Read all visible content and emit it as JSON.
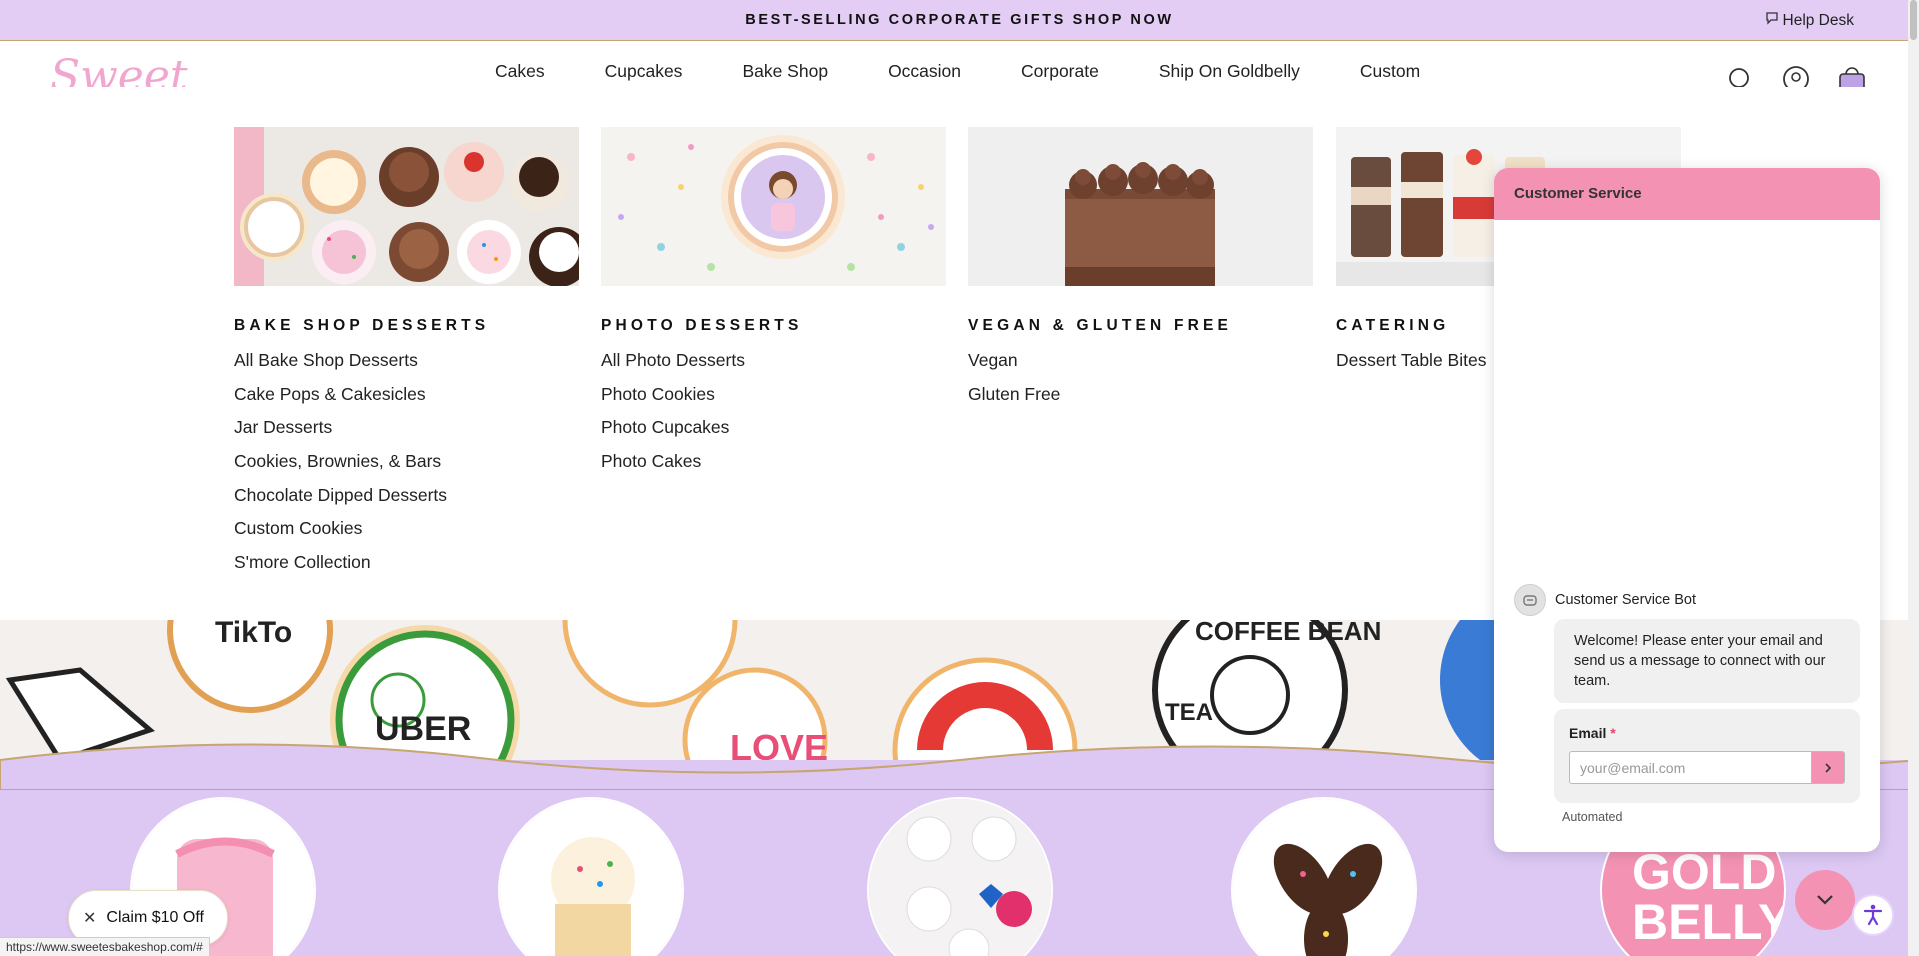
{
  "announcement": {
    "text": "BEST-SELLING CORPORATE GIFTS SHOP NOW",
    "help_desk": "Help Desk"
  },
  "header": {
    "logo_text": "Sweet E's",
    "nav": [
      "Cakes",
      "Cupcakes",
      "Bake Shop",
      "Occasion",
      "Corporate",
      "Ship On Goldbelly",
      "Custom"
    ],
    "active_nav": "Bake Shop",
    "icons": [
      "search-icon",
      "account-icon",
      "cart-icon"
    ]
  },
  "mega_menu": {
    "columns": [
      {
        "title": "BAKE SHOP DESSERTS",
        "links": [
          "All Bake Shop Desserts",
          "Cake Pops & Cakesicles",
          "Jar Desserts",
          "Cookies, Brownies, & Bars",
          "Chocolate Dipped Desserts",
          "Custom Cookies",
          "S'more Collection"
        ]
      },
      {
        "title": "PHOTO DESSERTS",
        "links": [
          "All Photo Desserts",
          "Photo Cookies",
          "Photo Cupcakes",
          "Photo Cakes"
        ]
      },
      {
        "title": "VEGAN & GLUTEN FREE",
        "links": [
          "Vegan",
          "Gluten Free"
        ]
      },
      {
        "title": "CATERING",
        "links": [
          "Dessert Table Bites"
        ]
      }
    ]
  },
  "hero": {
    "cookie_texts": [
      "TikTo",
      "UBER",
      "COFFEE BEAN",
      "TEA",
      "LOVE"
    ]
  },
  "category_circles": {
    "goldbelly_text": [
      "GOLD",
      "BELLY"
    ]
  },
  "chat": {
    "header": "Customer Service",
    "bot_name": "Customer Service Bot",
    "welcome": "Welcome! Please enter your email and send us a message to connect with our team.",
    "email_label": "Email",
    "required_mark": "*",
    "email_placeholder": "your@email.com",
    "automated": "Automated"
  },
  "promo": {
    "claim": "Claim $10 Off"
  },
  "status_bar": {
    "url": "https://www.sweetesbakeshop.com/#"
  },
  "colors": {
    "announce_bg": "#e3cdf4",
    "gold_accent": "#c7a56f",
    "pink": "#f492b4",
    "lavender": "#dcc8f3"
  }
}
